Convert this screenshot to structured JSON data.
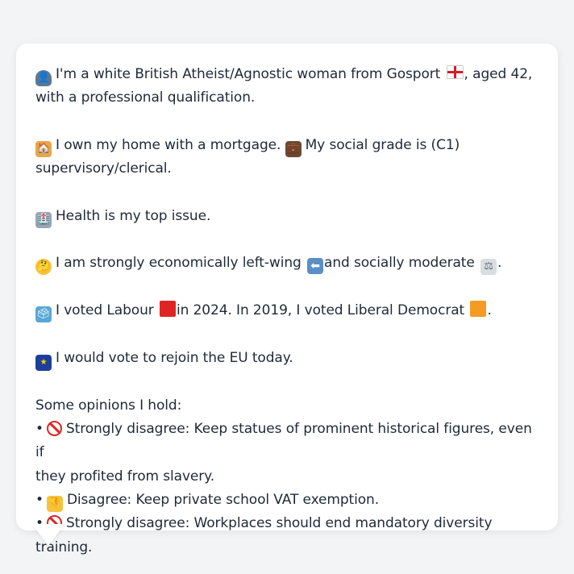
{
  "icons": {
    "person": "👤",
    "england_flag": "",
    "house": "🏠",
    "briefcase": "💼",
    "hospital": "🏥",
    "thinking": "🤔",
    "left_arrow": "⬅",
    "scales": "⚖",
    "ballot_box": "🗳",
    "red_square": "",
    "orange_square": "",
    "eu_flag": "★",
    "prohibited": "",
    "thumbs_down": "👎"
  },
  "colors": {
    "background": "#f3f4f6",
    "card": "#ffffff",
    "text": "#1f2937",
    "labour_red": "#e02424",
    "libdem_orange": "#f59a23",
    "eu_blue": "#1d3f9a"
  },
  "profile": {
    "line1_pre": "I'm a white British Atheist/Agnostic woman from Gosport",
    "line1_post": ", aged 42,",
    "line1_cont": "with a professional qualification.",
    "home_text": "I own my home with a mortgage.",
    "grade_text": "My social grade is (C1)",
    "grade_cont": "supervisory/clerical.",
    "health_text": "Health is my top issue.",
    "ideology_pre": "I am strongly economically left-wing",
    "ideology_mid": "and socially moderate",
    "ideology_end": ".",
    "vote_pre": "I voted Labour",
    "vote_mid": "in 2024. In 2019, I voted Liberal Democrat",
    "vote_end": ".",
    "eu_text": "I would vote to rejoin the EU today."
  },
  "opinions": {
    "heading": "Some opinions I hold:",
    "bullet": "•",
    "items": [
      {
        "text": "Strongly disagree: Keep statues of prominent historical figures, even if",
        "cont": "they profited from slavery."
      },
      {
        "text": "Disagree: Keep private school VAT exemption."
      },
      {
        "text": "Strongly disagree: Workplaces should end mandatory diversity training."
      }
    ]
  }
}
